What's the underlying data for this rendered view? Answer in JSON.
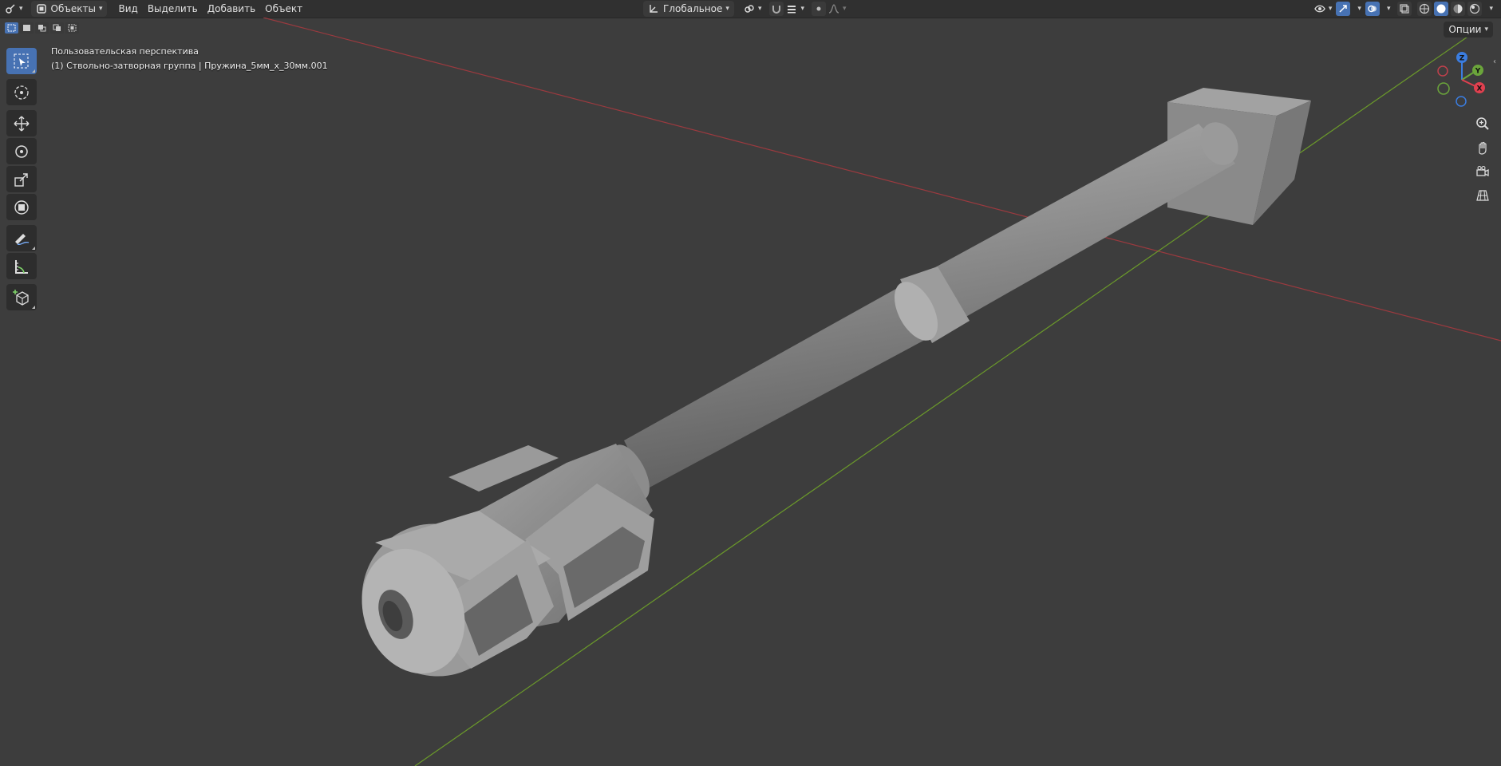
{
  "header": {
    "mode_label": "Объекты",
    "menus": [
      "Вид",
      "Выделить",
      "Добавить",
      "Объект"
    ],
    "transform_orientation": "Глобальное"
  },
  "viewport": {
    "view_name": "Пользовательская перспектива",
    "object_info": "(1) Ствольно-затворная группа | Пружина_5мм_х_30мм.001",
    "options_label": "Опции"
  },
  "gizmo": {
    "x_label": "X",
    "y_label": "Y",
    "z_label": "Z",
    "x_color": "#e0404f",
    "y_color": "#6ba53b",
    "z_color": "#3b7de0"
  },
  "colors": {
    "accent": "#4772b3",
    "axis_x_line": "#9b3a3f",
    "axis_y_line": "#6b9a2a",
    "background": "#3d3d3d"
  },
  "toolbar_tools": [
    "select-box",
    "cursor",
    "move",
    "rotate",
    "scale",
    "transform",
    "annotate",
    "measure",
    "add-cube"
  ]
}
